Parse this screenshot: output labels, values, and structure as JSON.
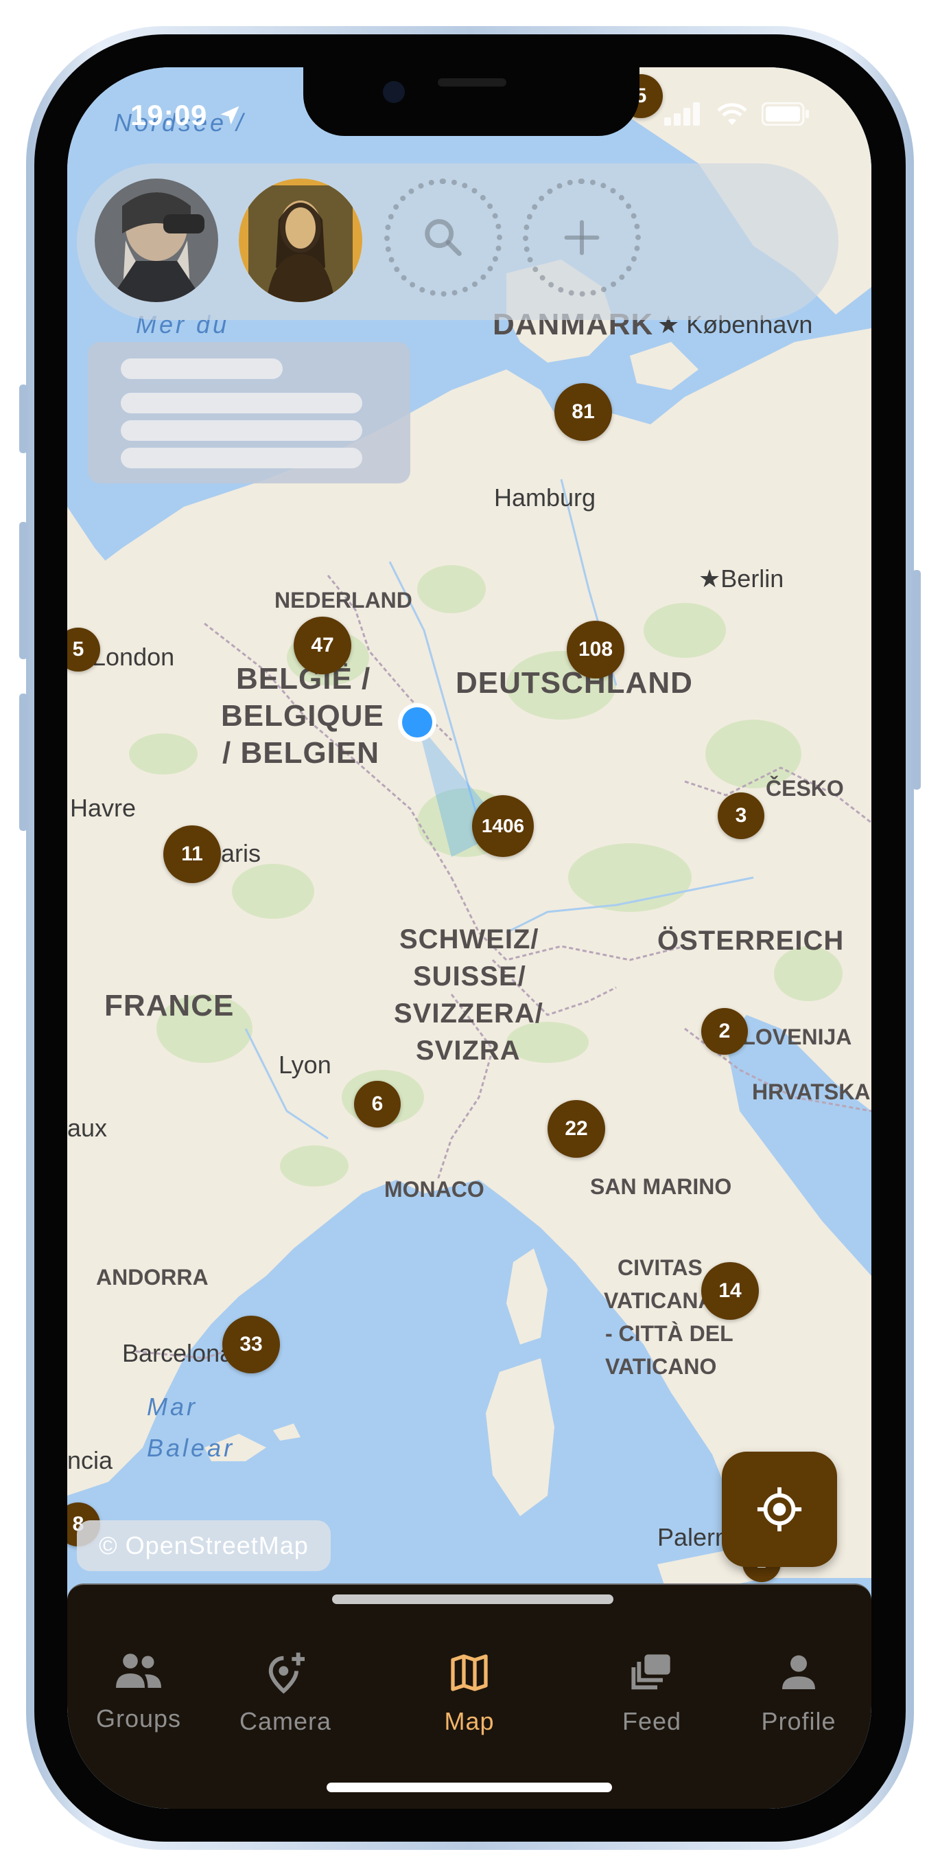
{
  "status_bar": {
    "time": "19:09"
  },
  "map": {
    "countries": [
      "DANMARK",
      "NEDERLAND",
      "BELGIË /",
      "BELGIQUE",
      "/ BELGIEN",
      "DEUTSCHLAND",
      "ČESKO",
      "SCHWEIZ/",
      "SUISSE/",
      "SVIZZERA/",
      "SVIZRA",
      "ÖSTERREICH",
      "FRANCE",
      "SLOVENIJA",
      "HRVATSKA",
      "MONACO",
      "SAN MARINO",
      "ANDORRA",
      "CIVITAS",
      "VATICANA",
      "- CITTÀ DEL",
      "VATICANO"
    ],
    "cities": [
      "København",
      "Hamburg",
      "Berlin",
      "London",
      "Havre",
      "Paris",
      "Lyon",
      "Barcelona",
      "aux",
      "ncia",
      "Palermo"
    ],
    "seas": [
      "Nordsee /",
      "Mar",
      "Balear",
      "Mer du"
    ],
    "clusters": [
      "81",
      "47",
      "108",
      "1406",
      "11",
      "3",
      "2",
      "6",
      "22",
      "14",
      "33",
      "5",
      "5",
      "8",
      "2"
    ]
  },
  "attribution": "© OpenStreetMap",
  "tabs": [
    {
      "label": "Groups",
      "icon": "groups-icon"
    },
    {
      "label": "Camera",
      "icon": "add-location-icon"
    },
    {
      "label": "Map",
      "icon": "map-icon",
      "active": true
    },
    {
      "label": "Feed",
      "icon": "feed-icon"
    },
    {
      "label": "Profile",
      "icon": "profile-icon"
    }
  ],
  "colors": {
    "accent": "#5e3a05",
    "tab_active": "#f2b56a",
    "tabbar_bg": "#1b140c",
    "water": "#a9cdf0",
    "land": "#f1ece0",
    "user_location": "#2f9bff"
  }
}
